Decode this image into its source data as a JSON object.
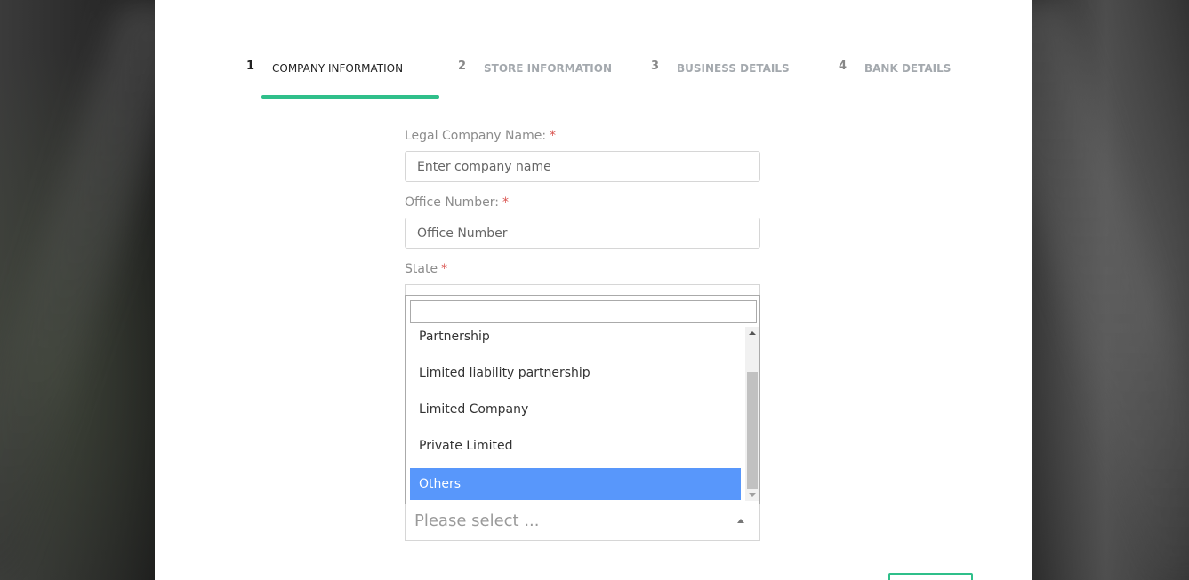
{
  "steps": [
    {
      "num": "1",
      "label": "COMPANY INFORMATION",
      "active": true
    },
    {
      "num": "2",
      "label": "STORE INFORMATION",
      "active": false
    },
    {
      "num": "3",
      "label": "BUSINESS DETAILS",
      "active": false
    },
    {
      "num": "4",
      "label": "BANK DETAILS",
      "active": false
    }
  ],
  "form": {
    "company_name": {
      "label": "Legal Company Name:",
      "required_mark": "*",
      "placeholder": "Enter company name",
      "value": ""
    },
    "office_number": {
      "label": "Office Number:",
      "required_mark": "*",
      "placeholder": "Office Number",
      "value": ""
    },
    "state": {
      "label": "State",
      "required_mark": "*"
    }
  },
  "dropdown": {
    "search_value": "",
    "options": [
      "Partnership",
      "Limited liability partnership",
      "Limited Company",
      "Private Limited",
      "Others"
    ],
    "highlighted_option": "Others",
    "select_placeholder": "Please select ..."
  },
  "colors": {
    "accent": "#2fbf8a",
    "highlight": "#5897fb",
    "required": "#d9534f"
  }
}
